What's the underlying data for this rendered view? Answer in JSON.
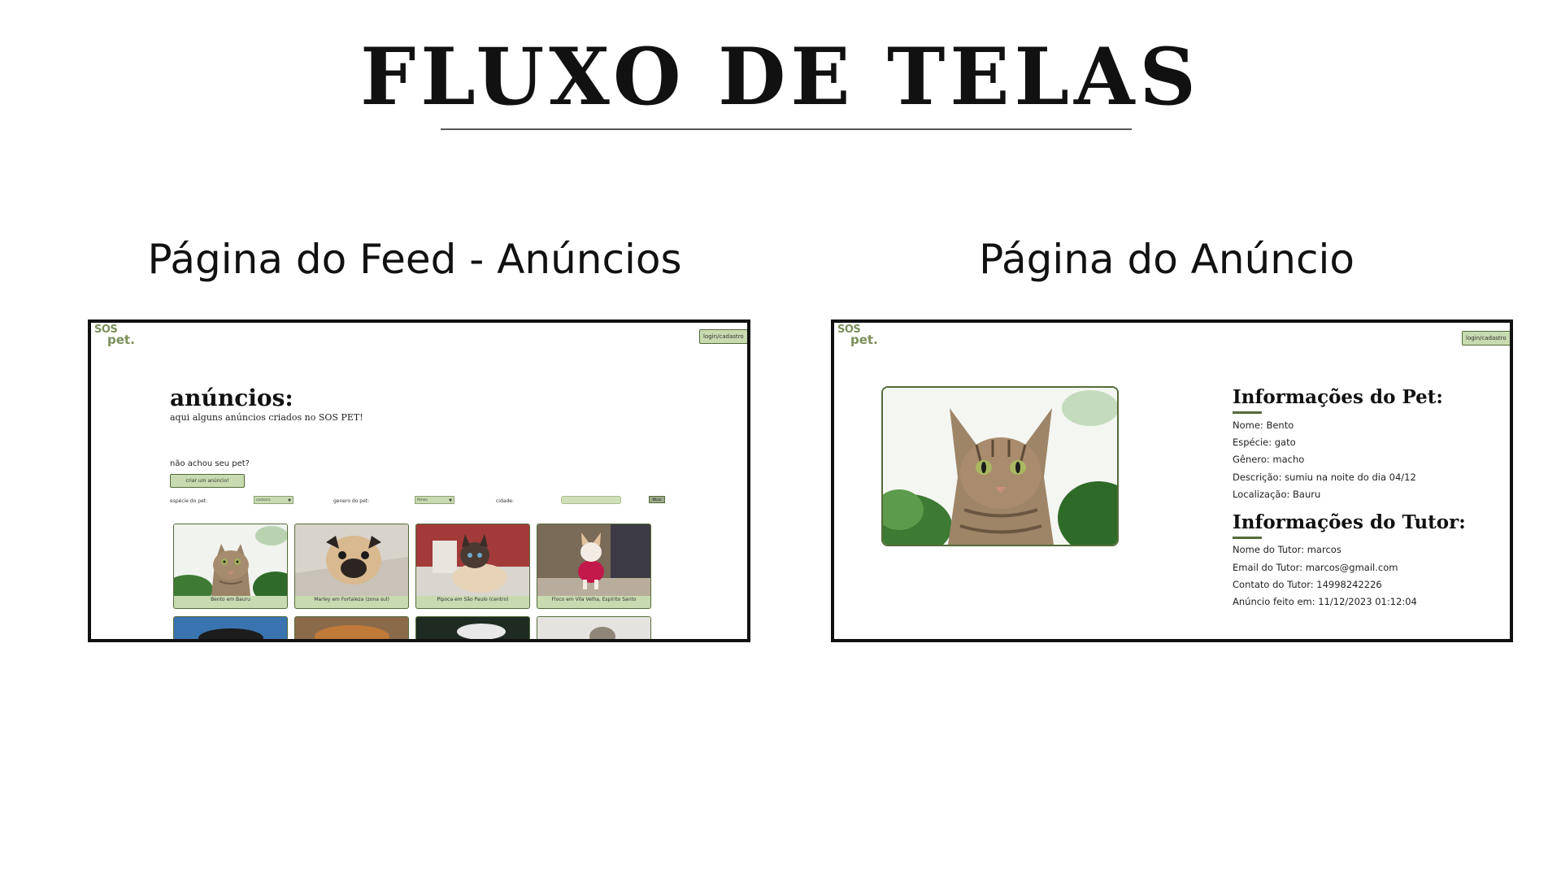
{
  "page": {
    "title": "FLUXO DE TELAS",
    "left_section_title": "Página do Feed - Anúncios",
    "right_section_title": "Página do Anúncio"
  },
  "logo": {
    "line1": "SOS",
    "line2": "pet."
  },
  "feed": {
    "login_label": "login/cadastro",
    "heading": "anúncios:",
    "subheading": "aqui alguns anúncios criados no SOS PET!",
    "not_found": "não achou seu pet?",
    "create_button": "criar um anúncio!",
    "filters": {
      "species_label": "espécie do pet:",
      "species_value": "cachorro",
      "gender_label": "genero do pet:",
      "gender_value": "fêmea",
      "city_label": "cidade:",
      "filter_button": "filtrar"
    },
    "cards": [
      {
        "caption": "Bento em Bauru"
      },
      {
        "caption": "Marley em Fortaleza (zona sul)"
      },
      {
        "caption": "Pipoca em São Paulo (centro)"
      },
      {
        "caption": "Floco em Vila Velha, Espírito Santo"
      }
    ]
  },
  "ad": {
    "login_label": "login/cadastro",
    "pet_info_title": "Informações do Pet:",
    "pet_lines": [
      "Nome: Bento",
      "Espécie: gato",
      "Gênero: macho",
      "Descrição: sumiu na noite do dia 04/12",
      "Localização: Bauru"
    ],
    "tutor_info_title": "Informações do Tutor:",
    "tutor_lines": [
      "Nome do Tutor: marcos",
      "Email do Tutor: marcos@gmail.com",
      "Contato do Tutor: 14998242226",
      "Anúncio feito em: 11/12/2023 01:12:04"
    ]
  },
  "colors": {
    "accent_green": "#c8dab0",
    "dark_green": "#556b3a"
  }
}
